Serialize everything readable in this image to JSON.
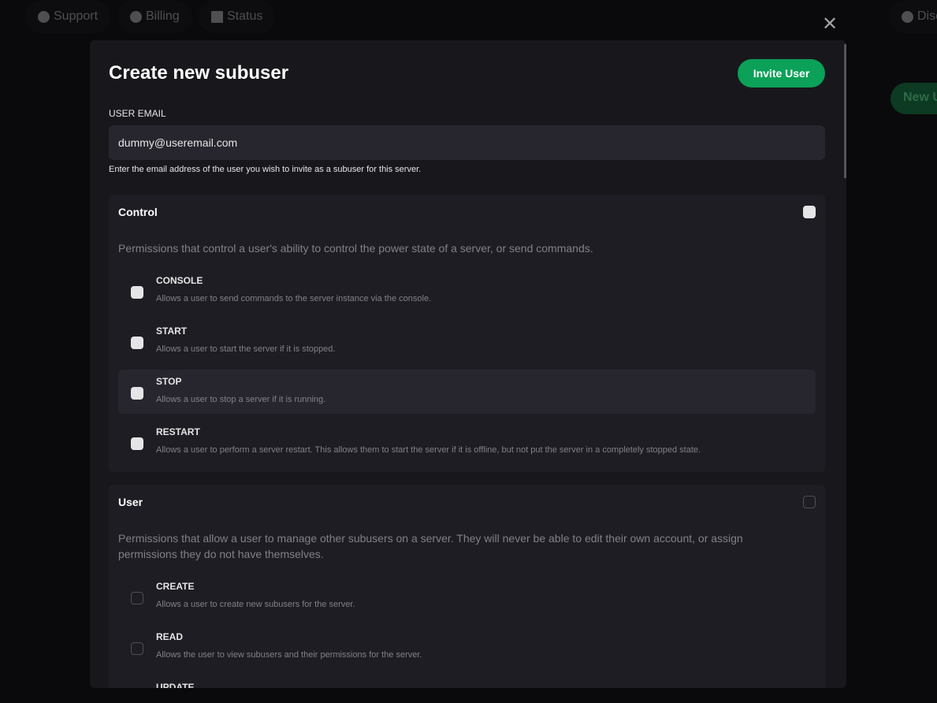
{
  "topnav": {
    "support": "Support",
    "billing": "Billing",
    "status": "Status",
    "discord": "Disc"
  },
  "background": {
    "new_user_button": "New U"
  },
  "modal": {
    "title": "Create new subuser",
    "invite_button": "Invite User",
    "email_label": "USER EMAIL",
    "email_value": "dummy@useremail.com",
    "email_help": "Enter the email address of the user you wish to invite as a subuser for this server.",
    "groups": [
      {
        "title": "Control",
        "description": "Permissions that control a user's ability to control the power state of a server, or send commands.",
        "checked": true,
        "permissions": [
          {
            "name": "CONSOLE",
            "description": "Allows a user to send commands to the server instance via the console.",
            "checked": true
          },
          {
            "name": "START",
            "description": "Allows a user to start the server if it is stopped.",
            "checked": true
          },
          {
            "name": "STOP",
            "description": "Allows a user to stop a server if it is running.",
            "checked": true
          },
          {
            "name": "RESTART",
            "description": "Allows a user to perform a server restart. This allows them to start the server if it is offline, but not put the server in a completely stopped state.",
            "checked": true
          }
        ]
      },
      {
        "title": "User",
        "description": "Permissions that allow a user to manage other subusers on a server. They will never be able to edit their own account, or assign permissions they do not have themselves.",
        "checked": false,
        "permissions": [
          {
            "name": "CREATE",
            "description": "Allows a user to create new subusers for the server.",
            "checked": false
          },
          {
            "name": "READ",
            "description": "Allows the user to view subusers and their permissions for the server.",
            "checked": false
          },
          {
            "name": "UPDATE",
            "description": "",
            "checked": false
          }
        ]
      }
    ]
  },
  "colors": {
    "accent": "#0ba158",
    "modal_bg": "#18181c",
    "card_bg": "#1e1d23"
  }
}
